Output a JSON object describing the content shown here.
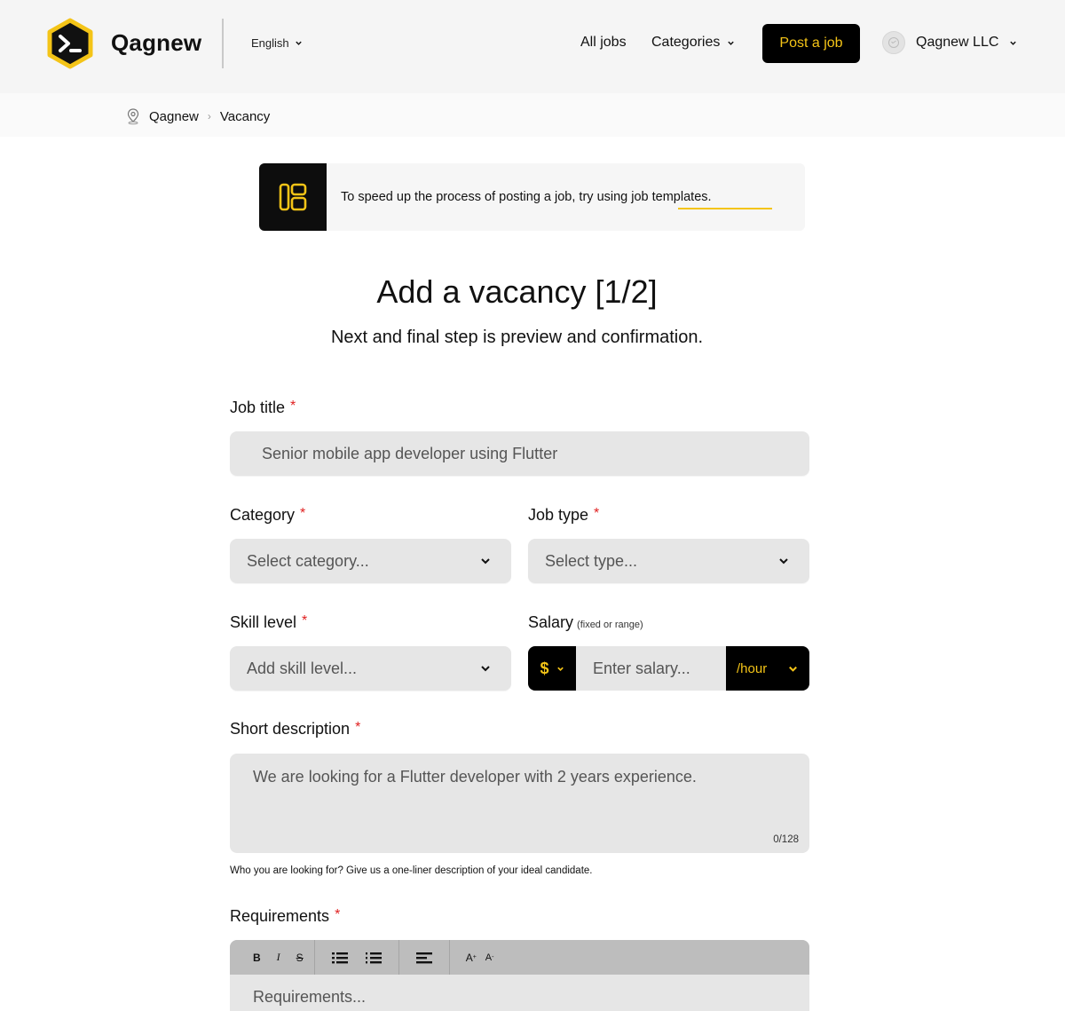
{
  "header": {
    "brand": "Qagnew",
    "language": "English",
    "nav": {
      "all_jobs": "All jobs",
      "categories": "Categories"
    },
    "post_job": "Post a job",
    "company": "Qagnew LLC",
    "accent_color": "#f4c417"
  },
  "breadcrumb": {
    "items": [
      "Qagnew",
      "Vacancy"
    ],
    "separator": "›"
  },
  "banner": {
    "text_before": "To speed up the process of posting a job, try using job ",
    "link": "templates",
    "text_after": "."
  },
  "page": {
    "title": "Add a vacancy [1/2]",
    "subtitle": "Next and final step is preview and confirmation."
  },
  "form": {
    "job_title": {
      "label": "Job title",
      "value": "Senior mobile app developer using Flutter"
    },
    "category": {
      "label": "Category",
      "placeholder": "Select category..."
    },
    "job_type": {
      "label": "Job type",
      "placeholder": "Select type..."
    },
    "skill_level": {
      "label": "Skill level",
      "placeholder": "Add skill level..."
    },
    "salary": {
      "label": "Salary",
      "note": "(fixed or range)",
      "currency": "$",
      "placeholder": "Enter salary...",
      "unit": "/hour"
    },
    "short_description": {
      "label": "Short description",
      "value": "We are looking for a Flutter developer with 2 years experience.",
      "counter": "0/128",
      "hint": "Who you are looking for? Give us a one-liner description of your ideal candidate."
    },
    "requirements": {
      "label": "Requirements",
      "placeholder": "Requirements...",
      "toolbar": {
        "bold": "B",
        "italic": "I",
        "strike": "S",
        "font_up": "A",
        "font_down": "A"
      }
    },
    "required_mark": "*"
  }
}
